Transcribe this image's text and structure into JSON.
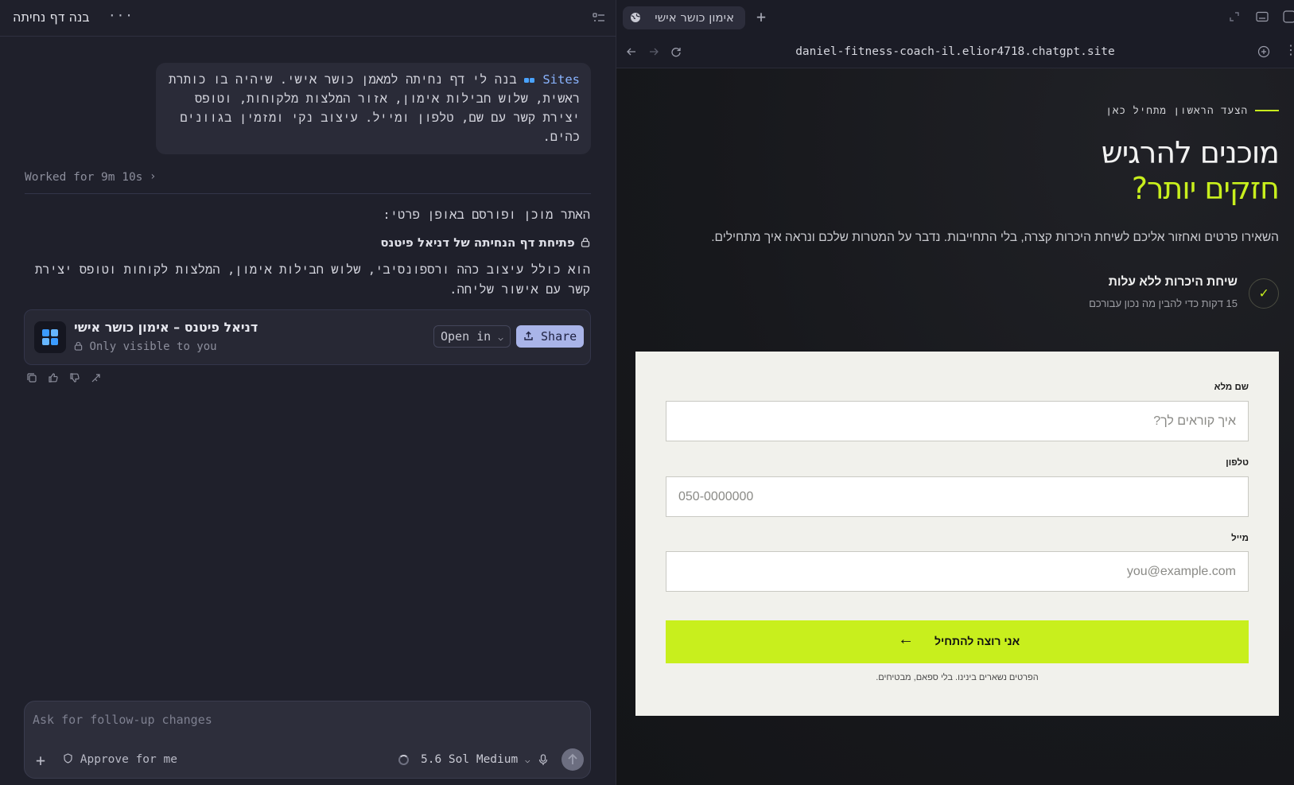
{
  "left": {
    "title": "בנה דף נחיתה",
    "more": "···",
    "user_message": {
      "chip": "Sites",
      "text": "בנה לי דף נחיתה למאמן כושר אישי. שיהיה בו כותרת ראשית, שלוש חבילות אימון, אזור המלצות מלקוחות, וטופס יצירת קשר עם שם, טלפון ומייל. עיצוב נקי ומזמין בגוונים כהים."
    },
    "worked": "Worked for 9m 10s",
    "assistant": {
      "ready": "האתר מוכן ופורסם באופן פרטי:",
      "open_link": "פתיחת דף הנחיתה של דניאל פיטנס",
      "description": "הוא כולל עיצוב כהה ורספונסיבי, שלוש חבילות אימון, המלצות לקוחות וטופס יצירת קשר עם אישור שליחה."
    },
    "site_card": {
      "name": "דניאל פיטנס – אימון כושר אישי",
      "visibility": "Only visible to you",
      "open_in": "Open in",
      "share": "Share"
    },
    "composer": {
      "placeholder": "Ask for follow-up changes",
      "approve": "Approve for me",
      "model": "5.6 Sol Medium"
    }
  },
  "browser": {
    "tab_title": "אימון כושר אישי",
    "url": "daniel-fitness-coach-il.elior4718.chatgpt.site"
  },
  "site": {
    "eyebrow": "הצעד הראשון מתחיל כאן",
    "hero_line1": "מוכנים להרגיש",
    "hero_line2": "חזקים יותר?",
    "subtitle": "השאירו פרטים ואחזור אליכם לשיחת היכרות קצרה, בלי התחייבות. נדבר על המטרות שלכם ונראה איך מתחילים.",
    "benefit": {
      "check": "✓",
      "title": "שיחת היכרות ללא עלות",
      "subtitle": "15 דקות כדי להבין מה נכון עבורכם"
    },
    "form": {
      "name_label": "שם מלא",
      "name_placeholder": "איך קוראים לך?",
      "phone_label": "טלפון",
      "phone_placeholder": "050-0000000",
      "email_label": "מייל",
      "email_placeholder": "you@example.com",
      "submit": "אני רוצה להתחיל",
      "submit_arrow": "←",
      "privacy": "הפרטים נשארים בינינו. בלי ספאם, מבטיחים."
    },
    "accent_color": "#c8ef1d"
  }
}
